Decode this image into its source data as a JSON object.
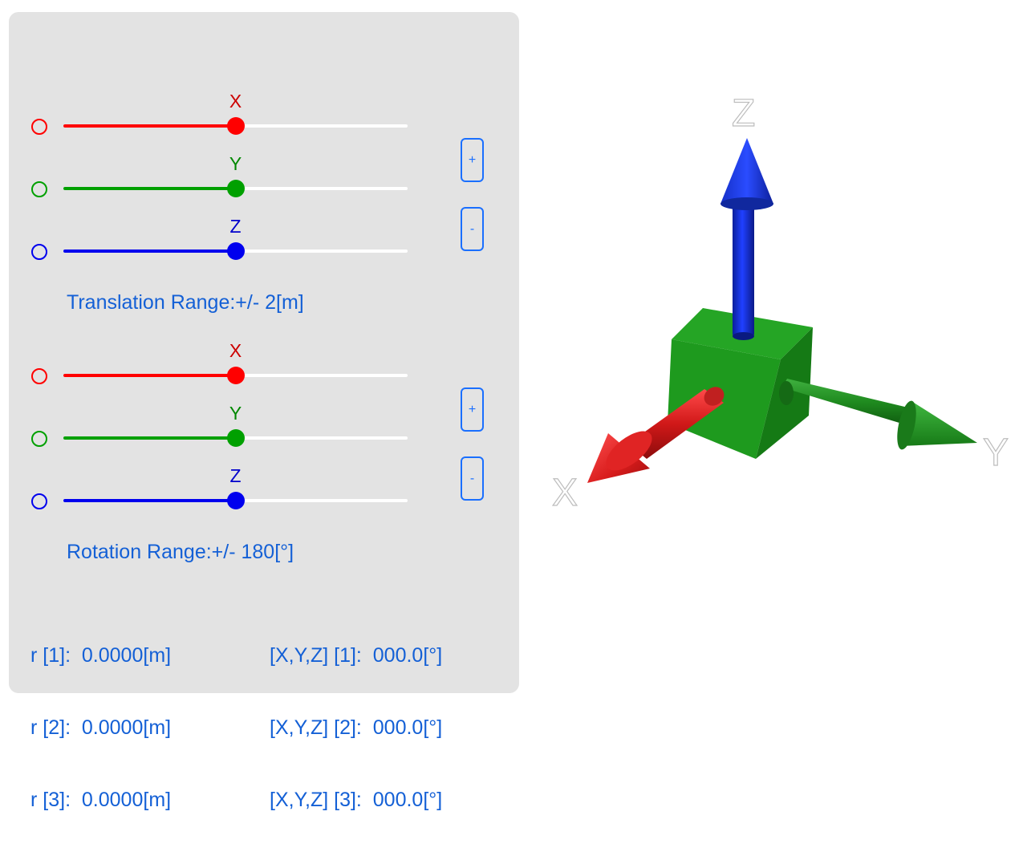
{
  "translation": {
    "sliders": [
      {
        "axis": "X",
        "color": "#ff0000",
        "value": 0.5
      },
      {
        "axis": "Y",
        "color": "#00a000",
        "value": 0.5
      },
      {
        "axis": "Z",
        "color": "#0000ee",
        "value": 0.5
      }
    ],
    "plus_label": "+",
    "minus_label": "-",
    "range_label": "Translation Range:+/- 2[m]"
  },
  "rotation": {
    "sliders": [
      {
        "axis": "X",
        "color": "#ff0000",
        "value": 0.5
      },
      {
        "axis": "Y",
        "color": "#00a000",
        "value": 0.5
      },
      {
        "axis": "Z",
        "color": "#0000ee",
        "value": 0.5
      }
    ],
    "plus_label": "+",
    "minus_label": "-",
    "range_label": "Rotation Range:+/- 180[°]"
  },
  "readouts": {
    "left": [
      "r [1]:  0.0000[m]",
      "r [2]:  0.0000[m]",
      "r [3]:  0.0000[m]"
    ],
    "right": [
      "[X,Y,Z] [1]:  000.0[°]",
      "[X,Y,Z] [2]:  000.0[°]",
      "[X,Y,Z] [3]:  000.0[°]"
    ]
  },
  "scene": {
    "axis_labels": {
      "x": "X",
      "y": "Y",
      "z": "Z"
    },
    "colors": {
      "x_axis": "#d42020",
      "y_axis": "#1f8f1f",
      "z_axis": "#1530d0",
      "cube": "#1f9a1f"
    }
  }
}
